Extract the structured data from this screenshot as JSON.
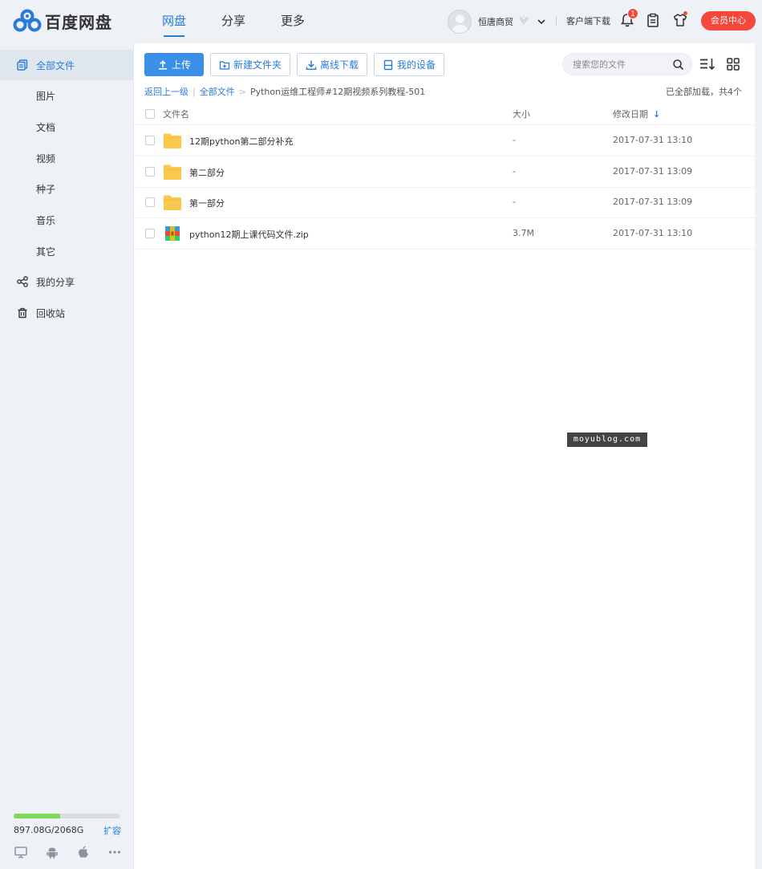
{
  "app": {
    "logo_text": "百度网盘",
    "brand_color": "#2a7bd9",
    "accent_red": "#f5483b"
  },
  "nav": {
    "items": [
      "网盘",
      "分享",
      "更多"
    ],
    "active_index": 0
  },
  "user": {
    "name": "恒唐商贸",
    "client_download": "客户端下载",
    "notification_count": "1",
    "vip_center": "会员中心"
  },
  "sidebar": {
    "all_files": "全部文件",
    "categories": [
      "图片",
      "文档",
      "视频",
      "种子",
      "音乐",
      "其它"
    ],
    "my_share": "我的分享",
    "recycle_bin": "回收站",
    "quota_text": "897.08G/2068G",
    "quota_fraction": 0.434,
    "expand": "扩容",
    "platform_icons": [
      "desktop-icon",
      "android-icon",
      "apple-icon",
      "more-icon"
    ]
  },
  "toolbar": {
    "upload": "上传",
    "new_folder": "新建文件夹",
    "offline_download": "离线下载",
    "my_devices": "我的设备",
    "search_placeholder": "搜索您的文件"
  },
  "breadcrumb": {
    "back": "返回上一级",
    "root": "全部文件",
    "current": "Python运维工程师#12期视频系列教程-501",
    "load_info": "已全部加载，共4个"
  },
  "table": {
    "col_name": "文件名",
    "col_size": "大小",
    "col_date": "修改日期",
    "rows": [
      {
        "name": "12期python第二部分补充",
        "size": "-",
        "date": "2017-07-31 13:10",
        "type": "folder"
      },
      {
        "name": "第二部分",
        "size": "-",
        "date": "2017-07-31 13:09",
        "type": "folder"
      },
      {
        "name": "第一部分",
        "size": "-",
        "date": "2017-07-31 13:09",
        "type": "folder"
      },
      {
        "name": "python12期上课代码文件.zip",
        "size": "3.7M",
        "date": "2017-07-31 13:10",
        "type": "zip"
      }
    ]
  },
  "watermark": "moyublog.com"
}
